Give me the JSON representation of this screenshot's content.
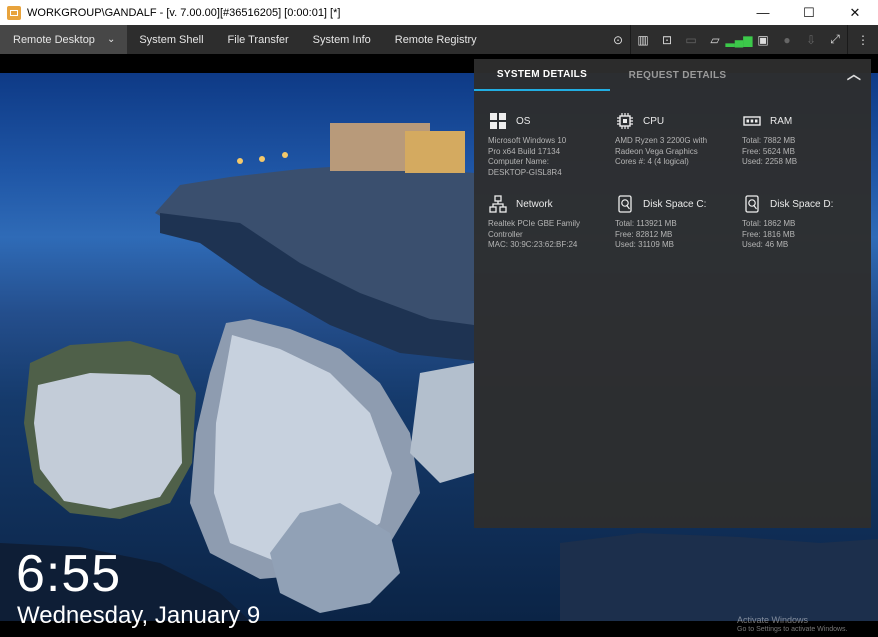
{
  "titlebar": {
    "title": "WORKGROUP\\GANDALF -  [v. 7.00.00][#36516205] [0:00:01] [*]",
    "minimize": "—",
    "maximize": "☐",
    "close": "✕"
  },
  "toolbar": {
    "tabs": [
      "Remote Desktop",
      "System Shell",
      "File Transfer",
      "System Info",
      "Remote Registry"
    ],
    "chevron": "⌄",
    "icons": {
      "monitor_toggle": "⊙",
      "layout": "▥",
      "screenshot": "⊡",
      "disabled_screen": "▭",
      "chat": "▱",
      "signal": "▂▄▆",
      "lock_screen": "▣",
      "record": "●",
      "download": "⇩",
      "fullscreen": "⤢",
      "more": "⋮"
    },
    "colors": {
      "signal": "#3cc94a",
      "accent": "#22aee2"
    }
  },
  "lockscreen": {
    "time": "6:55",
    "date": "Wednesday, January 9",
    "activate_title": "Activate Windows",
    "activate_sub": "Go to Settings to activate Windows.",
    "network_icon": "🖳"
  },
  "panel": {
    "tabs": [
      "SYSTEM DETAILS",
      "REQUEST DETAILS"
    ],
    "collapse_glyph": "︿",
    "sections": [
      {
        "title": "OS",
        "icon": "windows-logo-icon",
        "lines": [
          "Microsoft Windows 10",
          "Pro x64 Build 17134",
          "Computer Name:",
          "DESKTOP-GISL8R4"
        ]
      },
      {
        "title": "CPU",
        "icon": "cpu-chip-icon",
        "lines": [
          "AMD Ryzen 3 2200G with",
          "Radeon Vega Graphics",
          "Cores #: 4 (4 logical)"
        ]
      },
      {
        "title": "RAM",
        "icon": "ram-module-icon",
        "lines": [
          "Total: 7882 MB",
          "Free: 5624 MB",
          "Used: 2258 MB"
        ]
      },
      {
        "title": "Network",
        "icon": "network-icon",
        "lines": [
          "Realtek PCIe GBE Family",
          "Controller",
          "MAC: 30:9C:23:62:BF:24"
        ]
      },
      {
        "title": "Disk Space C:",
        "icon": "disk-icon",
        "lines": [
          "Total: 113921 MB",
          "Free: 82812 MB",
          "Used: 31109 MB"
        ]
      },
      {
        "title": "Disk Space D:",
        "icon": "disk-icon",
        "lines": [
          "Total: 1862 MB",
          "Free: 1816 MB",
          "Used: 46 MB"
        ]
      }
    ]
  }
}
